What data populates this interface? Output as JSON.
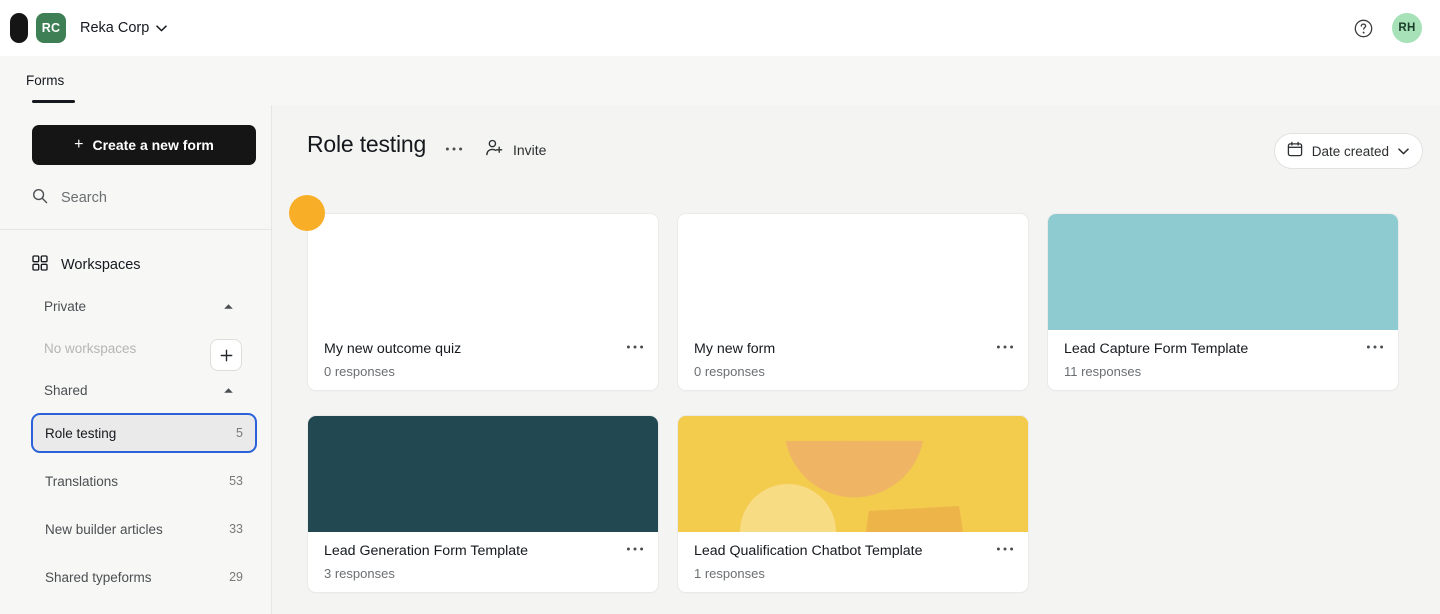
{
  "topbar": {
    "brand_mark_icon": "typeform-logo-mark",
    "org_initials": "RC",
    "org_name": "Reka Corp",
    "org_chevron_icon": "chevron-down-icon",
    "help_icon": "question-circle-icon",
    "user_initials": "RH",
    "org_avatar_color": "#3f7f55",
    "user_avatar_color": "#a6e1b8"
  },
  "tabs": [
    {
      "label": "Forms",
      "active": true
    }
  ],
  "sidebar": {
    "create_button": {
      "label": "Create a new form",
      "icon": "plus-icon"
    },
    "search": {
      "placeholder": "Search",
      "icon": "search-icon",
      "value": ""
    },
    "workspaces_header": {
      "label": "Workspaces",
      "icon": "grid-icon"
    },
    "add_workspace_button": {
      "icon": "plus-icon",
      "label": "+"
    },
    "groups": [
      {
        "label": "Private",
        "caret_icon": "caret-up-icon",
        "expanded": true,
        "empty_text": "No workspaces",
        "items": []
      },
      {
        "label": "Shared",
        "caret_icon": "caret-up-icon",
        "expanded": true,
        "empty_text": "",
        "items": [
          {
            "name": "Role testing",
            "count": "5",
            "selected": true
          },
          {
            "name": "Translations",
            "count": "53",
            "selected": false
          },
          {
            "name": "New builder articles",
            "count": "33",
            "selected": false
          },
          {
            "name": "Shared typeforms",
            "count": "29",
            "selected": false
          }
        ]
      }
    ]
  },
  "main": {
    "title": "Role testing",
    "title_menu_icon": "ellipsis-icon",
    "invite": {
      "label": "Invite",
      "icon": "person-add-icon"
    },
    "sort": {
      "label": "Date created",
      "icon": "calendar-icon",
      "chevron_icon": "chevron-down-icon"
    },
    "cards": [
      {
        "title": "My new outcome quiz",
        "responses": "0 responses",
        "thumb_kind": "blank",
        "thumb_color": "#ffffff",
        "menu_icon": "ellipsis-icon",
        "badge_icon": "orange-dot-indicator",
        "badge_color": "#f9ae28"
      },
      {
        "title": "My new form",
        "responses": "0 responses",
        "thumb_kind": "blank",
        "thumb_color": "#ffffff",
        "menu_icon": "ellipsis-icon"
      },
      {
        "title": "Lead Capture Form Template",
        "responses": "11 responses",
        "thumb_kind": "solid",
        "thumb_color": "#8ecbd0",
        "menu_icon": "ellipsis-icon"
      },
      {
        "title": "Lead Generation Form Template",
        "responses": "3 responses",
        "thumb_kind": "solid",
        "thumb_color": "#224952",
        "menu_icon": "ellipsis-icon"
      },
      {
        "title": "Lead Qualification Chatbot Template",
        "responses": "1 responses",
        "thumb_kind": "shapes-yellow",
        "thumb_color": "#f3cb4d",
        "shape_colors": [
          "#f0b465",
          "#f7dc84",
          "#edb44a"
        ],
        "menu_icon": "ellipsis-icon"
      }
    ]
  }
}
